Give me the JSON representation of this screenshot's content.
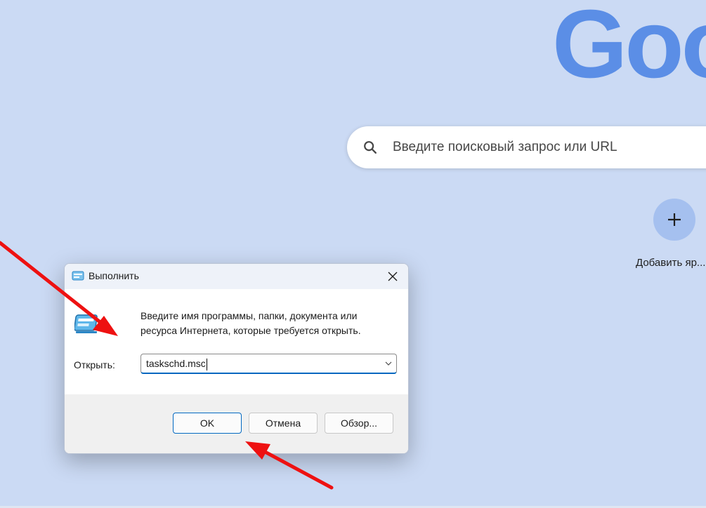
{
  "browser": {
    "logo_text": "Goog",
    "search_placeholder": "Введите поисковый запрос или URL",
    "add_shortcut_label": "Добавить яр..."
  },
  "run_dialog": {
    "title": "Выполнить",
    "description_line1": "Введите имя программы, папки, документа или",
    "description_line2": "ресурса Интернета, которые требуется открыть.",
    "open_label": "Открыть:",
    "open_value": "taskschd.msc",
    "buttons": {
      "ok": "OK",
      "cancel": "Отмена",
      "browse": "Обзор..."
    }
  },
  "annotations": {
    "arrow_color": "#ee1111",
    "arrows": [
      "arrow-to-run-icon",
      "arrow-to-ok-button"
    ]
  },
  "colors": {
    "background": "#cbdaf4",
    "logo": "#5b8ee6",
    "accent": "#0067c0"
  }
}
